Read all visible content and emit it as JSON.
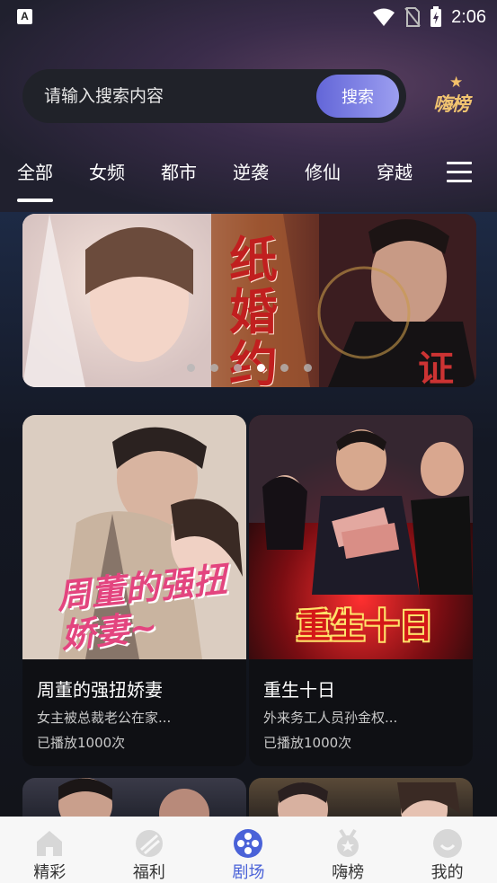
{
  "status_bar": {
    "time": "2:06",
    "app_icon_letter": "A"
  },
  "search": {
    "placeholder": "请输入搜索内容",
    "button_label": "搜索"
  },
  "rank_badge": {
    "label": "嗨榜"
  },
  "tabs": [
    {
      "label": "全部",
      "active": true
    },
    {
      "label": "女频",
      "active": false
    },
    {
      "label": "都市",
      "active": false
    },
    {
      "label": "逆袭",
      "active": false
    },
    {
      "label": "修仙",
      "active": false
    },
    {
      "label": "穿越",
      "active": false
    }
  ],
  "banner": {
    "title": "纸婚约",
    "stamp_text": "证",
    "slide_count": 6,
    "active_slide": 3
  },
  "dramas": [
    {
      "title": "周董的强扭娇妻",
      "poster_text": "周董的强扭娇妻~",
      "description": "女主被总裁老公在家...",
      "plays": "已播放1000次"
    },
    {
      "title": "重生十日",
      "poster_text": "重生十日",
      "description": "外来务工人员孙金权...",
      "plays": "已播放1000次"
    }
  ],
  "bottom_nav": [
    {
      "label": "精彩",
      "icon": "home-icon",
      "active": false
    },
    {
      "label": "福利",
      "icon": "welfare-icon",
      "active": false
    },
    {
      "label": "剧场",
      "icon": "film-reel-icon",
      "active": true
    },
    {
      "label": "嗨榜",
      "icon": "medal-icon",
      "active": false
    },
    {
      "label": "我的",
      "icon": "profile-icon",
      "active": false
    }
  ],
  "colors": {
    "accent": "#4a62d8",
    "search_button_start": "#6366d8",
    "search_button_end": "#9c9ef0",
    "rank_gold": "#f0c370"
  }
}
